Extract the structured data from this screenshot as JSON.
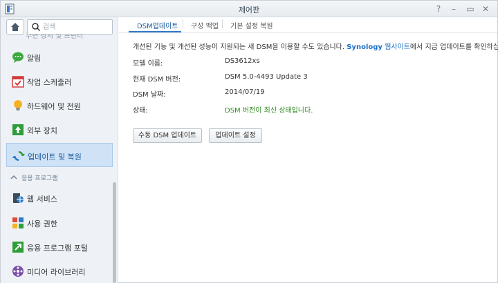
{
  "window": {
    "title": "제어판"
  },
  "search": {
    "placeholder": "검색"
  },
  "sidebar": {
    "cut_label": "주변 장치 및 프린터",
    "items": [
      {
        "label": "알림",
        "icon": "speech-bubble-icon"
      },
      {
        "label": "작업 스케줄러",
        "icon": "calendar-check-icon"
      },
      {
        "label": "하드웨어 및 전원",
        "icon": "lightbulb-icon"
      },
      {
        "label": "외부 장치",
        "icon": "external-device-icon"
      },
      {
        "label": "업데이트 및 복원",
        "icon": "update-restore-icon",
        "active": true
      }
    ],
    "section": "응용 프로그램",
    "section_items": [
      {
        "label": "웹 서비스",
        "icon": "web-services-icon"
      },
      {
        "label": "사용 권한",
        "icon": "privileges-icon"
      },
      {
        "label": "응용 프로그램 포털",
        "icon": "app-portal-icon"
      },
      {
        "label": "미디어 라이브러리",
        "icon": "media-library-icon"
      }
    ]
  },
  "tabs": [
    "DSM업데이트",
    "구성 백업",
    "기본 설정 복원"
  ],
  "description": {
    "before": "개선된 기능 및 개선된 성능이 지원되는 새 DSM을 이용할 수도 있습니다. ",
    "link_brand": "Synology",
    "link_text": " 웹사이트",
    "after": "에서 지금 업데이트를 확인하십시오."
  },
  "info": [
    {
      "label": "모델 이름:",
      "value": "DS3612xs"
    },
    {
      "label": "현재 DSM 버전:",
      "value": "DSM 5.0-4493 Update 3"
    },
    {
      "label": "DSM 날짜:",
      "value": "2014/07/19"
    },
    {
      "label": "상태:",
      "value": "DSM 버전이 최신 상태입니다."
    }
  ],
  "buttons": {
    "manual_update": "수동 DSM 업데이트",
    "update_settings": "업데이트 설정"
  },
  "colors": {
    "accent": "#1a6fc7",
    "status_ok": "#2e8b1f",
    "active_bg": "#cfe2f6"
  }
}
